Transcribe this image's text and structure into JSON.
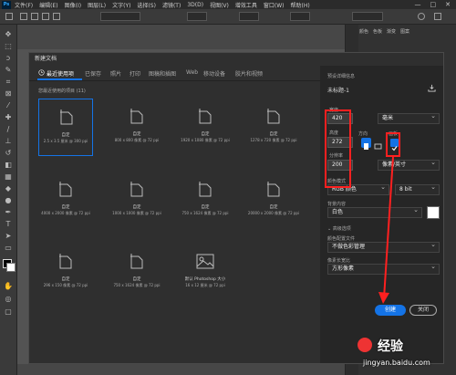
{
  "menubar": {
    "items": [
      "文件(F)",
      "编辑(E)",
      "图像(I)",
      "图层(L)",
      "文字(Y)",
      "选择(S)",
      "滤镜(T)",
      "3D(D)",
      "视图(V)",
      "增效工具",
      "窗口(W)",
      "帮助(H)"
    ],
    "window_controls": [
      "—",
      "□",
      "✕"
    ]
  },
  "right_panel": {
    "tabs": [
      "颜色",
      "色板",
      "渐变",
      "图案"
    ],
    "extra": [
      "属性",
      "调整",
      "库"
    ]
  },
  "dialog": {
    "title": "新建文档",
    "tabs": [
      "最近使用项",
      "已保存",
      "照片",
      "打印",
      "图稿和插图",
      "Web",
      "移动设备",
      "胶片和视频"
    ],
    "recent_header": "您最近使用的项目 (11)",
    "presets": [
      {
        "name": "自定",
        "dims": "2.5 x 3.5 厘米 @ 300 ppi"
      },
      {
        "name": "自定",
        "dims": "800 x 800 像素 @ 72 ppi"
      },
      {
        "name": "自定",
        "dims": "1920 x 1080 像素 @ 72 ppi"
      },
      {
        "name": "自定",
        "dims": "1278 x 720 像素 @ 72 ppi"
      },
      {
        "name": "自定",
        "dims": "4000 x 2000 像素 @ 72 ppi"
      },
      {
        "name": "自定",
        "dims": "1000 x 1000 像素 @ 72 ppi"
      },
      {
        "name": "自定",
        "dims": "750 x 1624 像素 @ 72 ppi"
      },
      {
        "name": "自定",
        "dims": "20000 x 2000 像素 @ 72 ppi"
      },
      {
        "name": "自定",
        "dims": "296 x 150 像素 @ 72 ppi"
      },
      {
        "name": "自定",
        "dims": "750 x 1624 像素 @ 72 ppi"
      },
      {
        "name": "默认 Photoshop 大小",
        "dims": "16 x 12 厘米 @ 72 ppi"
      }
    ],
    "details": {
      "section_title": "预设详细信息",
      "doc_name": "未标题-1",
      "width_label": "宽度",
      "width_value": "420",
      "width_unit": "毫米",
      "height_label": "高度",
      "height_value": "272",
      "orientation_label": "方向",
      "artboard_label": "画板",
      "resolution_label": "分辨率",
      "resolution_value": "200",
      "resolution_unit": "像素/英寸",
      "color_mode_label": "颜色模式",
      "color_mode_value": "RGB 颜色",
      "bit_depth": "8 bit",
      "background_label": "背景内容",
      "background_value": "白色",
      "advanced_label": "高级选项",
      "color_profile_label": "颜色配置文件",
      "color_profile_value": "不做色彩管理",
      "pixel_aspect_label": "像素长宽比",
      "pixel_aspect_value": "方形像素",
      "create_label": "创建",
      "close_label": "关闭"
    }
  },
  "watermark": {
    "brand": "经验",
    "url": "jingyan.baidu.com"
  },
  "colors": {
    "accent": "#1473e6",
    "annotation": "#ff2020"
  }
}
